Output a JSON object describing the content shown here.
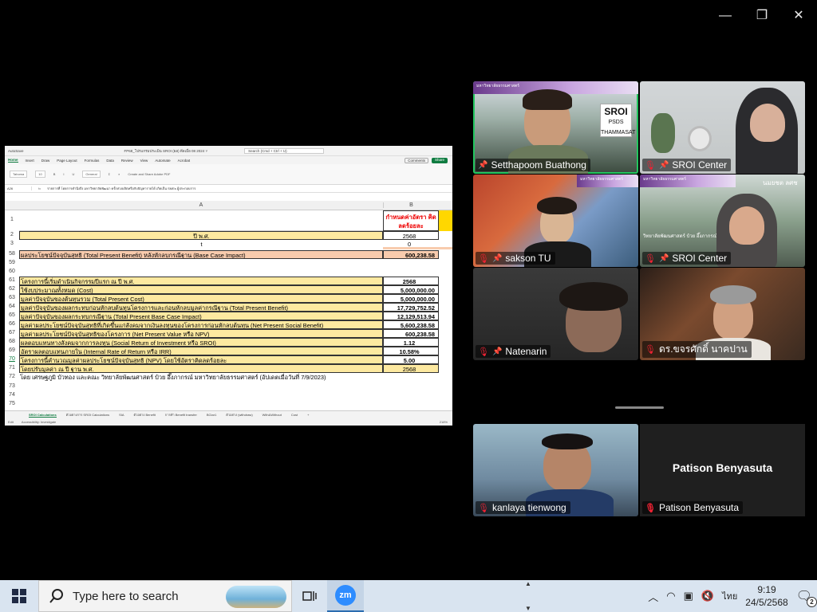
{
  "window_controls": {
    "minimize": "—",
    "restore": "❐",
    "close": "✕"
  },
  "excel": {
    "title_left": "AutoSave",
    "file_title": "FP68_โปรแกรมประเมิน SROI (ผล) ดีลเมื่อ 08 2024 ˅",
    "search_placeholder": "Search (Cmd + Ctrl + U)",
    "menu": [
      "Home",
      "Insert",
      "Draw",
      "Page Layout",
      "Formulas",
      "Data",
      "Review",
      "View",
      "Automate",
      "Acrobat"
    ],
    "comments_label": "Comments",
    "share_label": "Share",
    "ribbon": {
      "font": "Tahoma",
      "size": "10",
      "format": "General",
      "create_pdf": "Create and Share Adobe PDF"
    },
    "cell_ref": "A26",
    "formula": "รายการที่ โดยการคำนึงถึง มหาวิทยาลัยพัฒนา ครั้งห่วงผลิตหรือกับปัญหารายได้ เกิดเป็น SMEs ผู้ประกอบการ",
    "col_a": "A",
    "col_b": "B",
    "header_b": "กำหนดค่าอัตรา คิดลดร้อยละ",
    "rows": {
      "r1": {
        "num": "1"
      },
      "r2": {
        "num": "2",
        "a": "ปี พ.ศ.",
        "b": "2568"
      },
      "r3": {
        "num": "3",
        "a": "t",
        "b": "0"
      },
      "r58": {
        "num": "58",
        "a": "ผลประโยชน์ปัจจุบันสุทธิ (Total Present Benefit) หลังหักลบกรณีฐาน (Base Case Impact)",
        "b": "600,238.58"
      },
      "r59": {
        "num": "59"
      },
      "r60": {
        "num": "60"
      },
      "r61": {
        "num": "61",
        "a": "โครงการนี้เริ่มดำเนินกิจกรรมปีแรก ณ ปี พ.ศ.",
        "b": "2568"
      },
      "r62": {
        "num": "62",
        "a": "ใช้งบประมาณทั้งหมด (Cost)",
        "b": "5,000,000.00"
      },
      "r63": {
        "num": "63",
        "a": "มูลค่าปัจจุบันของต้นทุนรวม (Total Present Cost)",
        "b": "5,000,000.00"
      },
      "r64": {
        "num": "64",
        "a": "มูลค่าปัจจุบันของผลกระทบก่อนหักลบต้นทุนโครงการและก่อนหักลบมูลค่ากรณีฐาน (Total Present Benefit)",
        "b": "17,729,752.52"
      },
      "r65": {
        "num": "65",
        "a": "มูลค่าปัจจุบันของผลกระทบกรณีฐาน (Total Present Base Case Impact)",
        "b": "12,129,513.94"
      },
      "r66": {
        "num": "66",
        "a": "มูลค่าผลประโยชน์ปัจจุบันสุทธิที่เกิดขึ้นแก่สังคมจากเงินลงทุนของโครงการก่อนหักลบต้นทุน (Net Present Social Benefit)",
        "b": "5,600,238.58"
      },
      "r67": {
        "num": "67",
        "a": "มูลค่าผลประโยชน์ปัจจุบันสุทธิของโครงการ (Net Present Value หรือ NPV)",
        "b": "600,238.58"
      },
      "r68": {
        "num": "68",
        "a": "ผลตอบแทนทางสังคมจากการลงทุน (Social Return of Investment หรือ SROI)",
        "b": "1.12"
      },
      "r69": {
        "num": "69",
        "a": "อัตราผลตอบแทนภายใน  (Internal Rate of Return หรือ IRR)",
        "b": "10.58%"
      },
      "r70": {
        "num": "70",
        "a": "โครงการนี้คำนวณมูลค่าผลประโยชน์ปัจจุบันสุทธิ (NPV) โดยใช้อัตราคิดลดร้อยละ",
        "b": "5.00"
      },
      "r71": {
        "num": "71",
        "a": "โดยปรับมูลค่า ณ ปี ฐาน พ.ศ.",
        "b": "2568"
      },
      "r72": {
        "num": "72",
        "a": "โดย เศรษฐภูมิ บัวทอง และคณะ วิทยาลัยพัฒนศาสตร์ ป๋วย อึ๊งภากรณ์ มหาวิทยาลัยธรรมศาสตร์ (อัปเดตเมื่อวันที่ 7/9/2023)"
      },
      "r73": {
        "num": "73"
      },
      "r74": {
        "num": "74"
      },
      "r75": {
        "num": "75"
      }
    },
    "sheet_tabs": [
      "SROI Calculations",
      "ตัวอย่างการ SROI Calculations",
      "SIA",
      "ตัวอย่าง Benefit",
      "การทำ Benefit transfer",
      "BCtar1",
      "ตัวอย่าง (withdraw)",
      "With&Without",
      "Cost",
      "+"
    ],
    "status": {
      "mode": "Edit",
      "accessibility": "Accessibility: Investigate",
      "zoom": "218%"
    }
  },
  "participants": [
    {
      "name": "Setthapoom Buathong",
      "active": true
    },
    {
      "name": "SROI Center"
    },
    {
      "name": "sakson TU"
    },
    {
      "name": "SROI Center"
    },
    {
      "name": "Natenarin"
    },
    {
      "name": "ดร.ขจรศักดิ์ นาคปาน"
    },
    {
      "name": "kanlaya tienwong"
    },
    {
      "name": "Patison Benyasuta",
      "display": "Patison Benyasuta"
    }
  ],
  "banner_text": "มหาวิทยาลัยธรรมศาสตร์",
  "banner_text_2": "วิทยาลัยพัฒนศาสตร์ ป๋วย อึ๊งภากรณ์",
  "sroi_badge": {
    "title": "SROI",
    "sub": "PSDS",
    "sub2": "THAMMASAT"
  },
  "bg_sign": "นมยชต ลศช",
  "taskbar": {
    "search_placeholder": "Type here to search",
    "zoom_label": "zm",
    "lang": "ไทย",
    "time": "9:19",
    "date": "24/5/2568",
    "notifications": "2"
  }
}
